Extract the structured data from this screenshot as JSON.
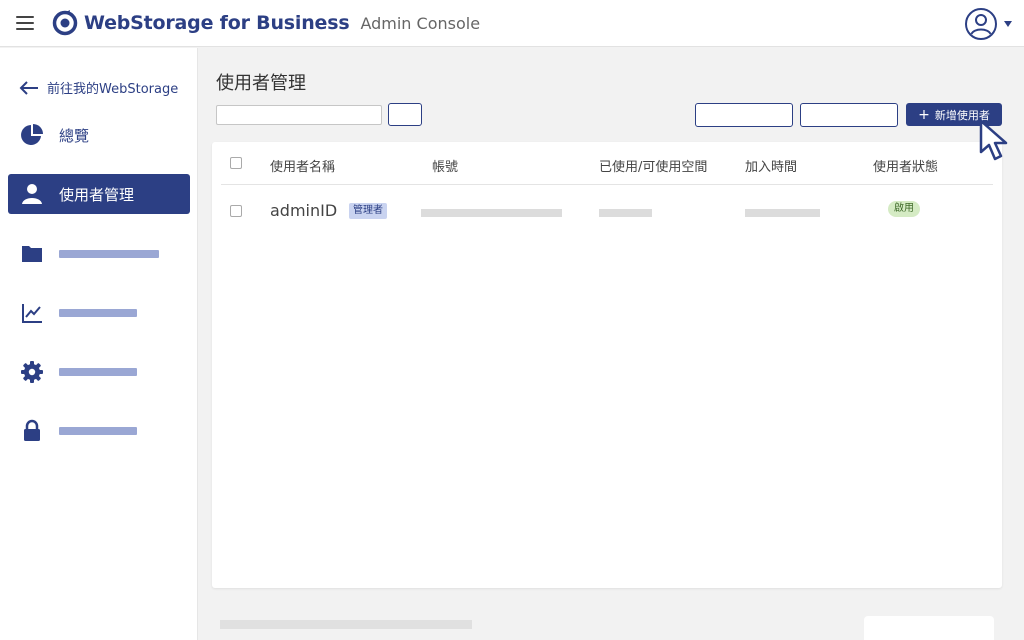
{
  "header": {
    "brand": "WebStorage for Business",
    "subtitle": "Admin Console",
    "icons": {
      "menu": "hamburger-menu-icon",
      "logo": "webstorage-logo-icon",
      "avatar": "user-circle-icon",
      "caret": "caret-down-icon"
    }
  },
  "sidebar": {
    "back_label": "前往我的WebStorage",
    "items": [
      {
        "label": "總覽",
        "icon": "pie-chart-icon",
        "active": false
      },
      {
        "label": "使用者管理",
        "icon": "user-icon",
        "active": true
      },
      {
        "label": "",
        "icon": "folder-icon",
        "active": false
      },
      {
        "label": "",
        "icon": "line-chart-icon",
        "active": false
      },
      {
        "label": "",
        "icon": "gear-icon",
        "active": false
      },
      {
        "label": "",
        "icon": "lock-icon",
        "active": false
      }
    ]
  },
  "main": {
    "title": "使用者管理",
    "search": {
      "value": "",
      "placeholder": ""
    },
    "add_user_label": "新增使用者",
    "table": {
      "columns": [
        "使用者名稱",
        "帳號",
        "已使用/可使用空間",
        "加入時間",
        "使用者狀態"
      ],
      "rows": [
        {
          "name": "adminID",
          "role_badge": "管理者",
          "status": "啟用"
        }
      ]
    }
  },
  "colors": {
    "brand": "#2c3f84",
    "placeholder": "#9aa7d4",
    "status_green": "#d5ebc4"
  }
}
